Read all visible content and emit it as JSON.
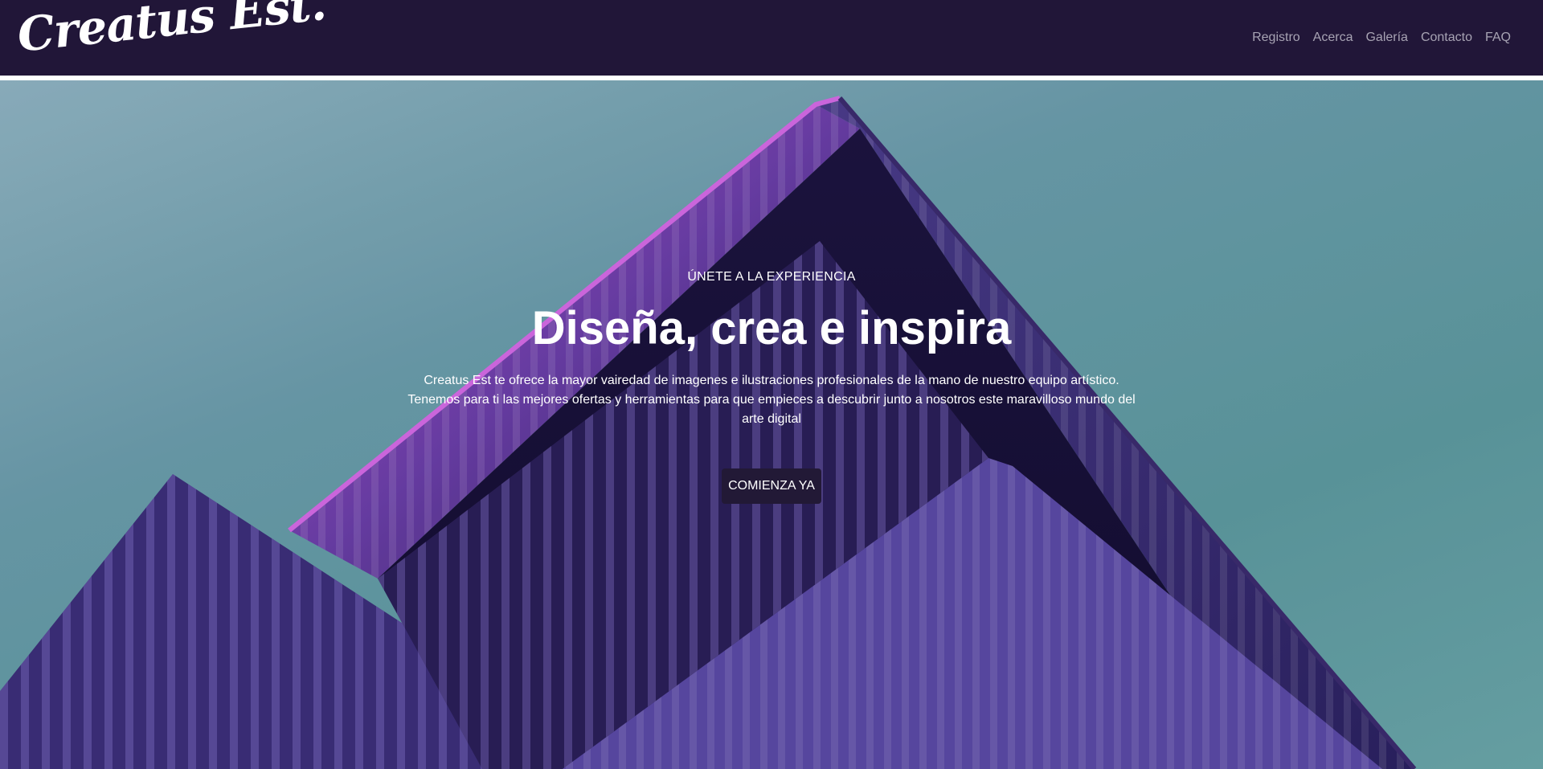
{
  "navbar": {
    "brand": "Creatus Est.",
    "links": [
      "Registro",
      "Acerca",
      "Galería",
      "Contacto",
      "FAQ"
    ]
  },
  "hero": {
    "eyebrow": "ÚNETE A LA EXPERIENCIA",
    "headline": "Diseña, crea e inspira",
    "lead": "Creatus Est te ofrece la mayor vairedad de imagenes e ilustraciones profesionales de la mano de nuestro equipo artístico. Tenemos para ti las mejores ofertas y herramientas para que empieces a descubrir junto a nosotros este maravilloso mundo del arte digital",
    "cta_label": "COMIENZA YA"
  },
  "colors": {
    "navbar_bg": "#211638",
    "cta_bg": "#221936",
    "building_purple": "#5b3f9a",
    "building_magenta": "#c25ed8",
    "sky_teal": "#5c9aa0"
  }
}
